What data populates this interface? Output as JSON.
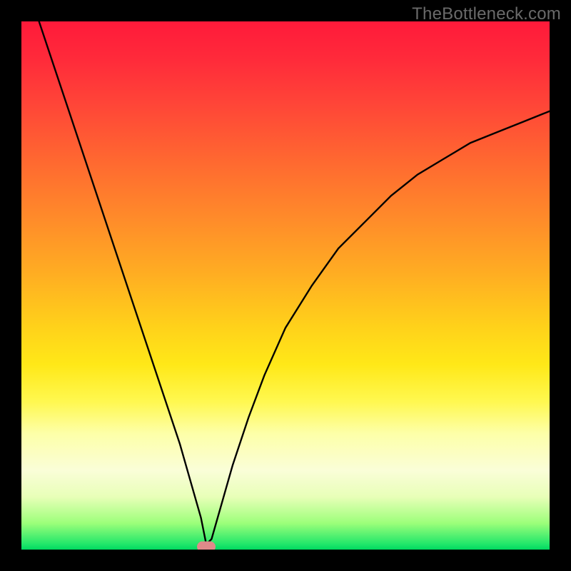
{
  "watermark": "TheBottleneck.com",
  "chart_data": {
    "type": "line",
    "title": "",
    "xlabel": "",
    "ylabel": "",
    "xlim": [
      0,
      100
    ],
    "ylim": [
      0,
      100
    ],
    "series": [
      {
        "name": "curve",
        "x": [
          0,
          3,
          6,
          9,
          12,
          15,
          18,
          21,
          24,
          27,
          30,
          32,
          34,
          35,
          36,
          38,
          40,
          43,
          46,
          50,
          55,
          60,
          65,
          70,
          75,
          80,
          85,
          90,
          95,
          100
        ],
        "values": [
          110,
          101,
          92,
          83,
          74,
          65,
          56,
          47,
          38,
          29,
          20,
          13,
          6,
          1,
          2,
          9,
          16,
          25,
          33,
          42,
          50,
          57,
          62,
          67,
          71,
          74,
          77,
          79,
          81,
          83
        ]
      }
    ],
    "marker": {
      "x": 35,
      "y": 0.5
    },
    "colors": {
      "curve": "#000000",
      "marker": "#e08a8a"
    }
  }
}
